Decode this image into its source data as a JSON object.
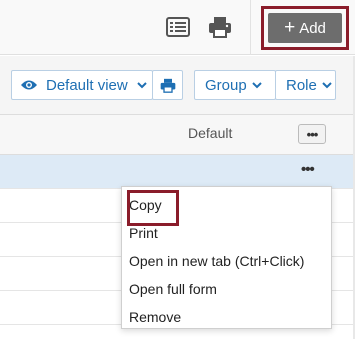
{
  "header": {
    "add_label": "Add",
    "icons": [
      "list-icon",
      "print-icon"
    ]
  },
  "toolbar": {
    "view_label": "Default view",
    "group_label": "Group",
    "role_label": "Role"
  },
  "grid": {
    "columns": [
      "Default"
    ]
  },
  "context_menu": {
    "items": [
      "Copy",
      "Print",
      "Open in new tab (Ctrl+Click)",
      "Open full form",
      "Remove"
    ]
  },
  "colors": {
    "accent": "#1e6fb3",
    "highlight": "#8a1c2a",
    "selected_row": "#ddeaf6",
    "add_button": "#6d6d6d"
  }
}
